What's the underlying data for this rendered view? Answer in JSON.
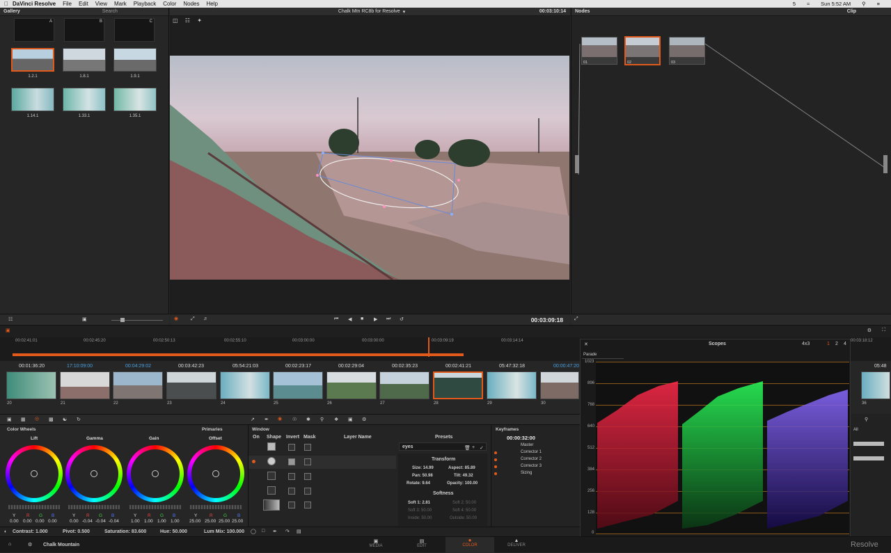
{
  "menubar": {
    "app": "DaVinci Resolve",
    "items": [
      "File",
      "Edit",
      "View",
      "Mark",
      "Playback",
      "Color",
      "Nodes",
      "Help"
    ],
    "clock": "Sun 5:52 AM",
    "battery": "5"
  },
  "gallery": {
    "title": "Gallery",
    "search_placeholder": "Search",
    "albums": [
      "A",
      "B",
      "C"
    ],
    "stills": [
      "1.2.1",
      "1.8.1",
      "1.9.1",
      "1.14.1",
      "1.33.1",
      "1.35.1"
    ]
  },
  "viewer": {
    "title": "Chalk Mtn RC8b for Resolve",
    "timecode_top": "00:03:10:14",
    "timecode": "00:03:09:18"
  },
  "nodes": {
    "title": "Nodes",
    "clip_label": "Clip",
    "node_labels": [
      "01",
      "02",
      "03"
    ]
  },
  "ruler": {
    "ticks": [
      "00:02:41:01",
      "00:02:45:20",
      "00:02:50:13",
      "00:02:55:10",
      "00:03:00:00",
      "00:03:00:00",
      "00:03:09:19",
      "00:03:14:14",
      "00:03:18:12"
    ]
  },
  "clips": {
    "timecodes": [
      "00:01:36:20",
      "17:10:09:00",
      "00:04:29:02",
      "00:03:42:23",
      "05:54:21:03",
      "00:02:23:17",
      "00:02:29:04",
      "00:02:35:23",
      "00:02:41:21",
      "05:47:32:18",
      "00:00:47:20",
      "05:48"
    ],
    "numbers": [
      "20",
      "21",
      "22",
      "23",
      "24",
      "25",
      "26",
      "27",
      "28",
      "29",
      "30",
      "36"
    ],
    "track": "V1"
  },
  "color_wheels": {
    "title": "Color Wheels",
    "mode": "Primaries",
    "wheels": [
      "Lift",
      "Gamma",
      "Gain",
      "Offset"
    ],
    "channels": [
      "Y",
      "R",
      "G",
      "B"
    ],
    "values": [
      [
        "0.00",
        "0.00",
        "0.00",
        "0.00"
      ],
      [
        "0.00",
        "-0.04",
        "-0.04",
        "-0.04"
      ],
      [
        "1.00",
        "1.00",
        "1.00",
        "1.00"
      ],
      [
        "25.00",
        "25.00",
        "25.00",
        "25.00"
      ]
    ]
  },
  "bottom_params": {
    "contrast": "Contrast: 1.000",
    "pivot": "Pivot: 0.500",
    "saturation": "Saturation: 83.600",
    "hue": "Hue: 50.000",
    "lummix": "Lum Mix: 100.000"
  },
  "window": {
    "title": "Window",
    "cols": [
      "On",
      "Shape",
      "Invert",
      "Mask",
      "Layer Name"
    ],
    "presets": "Presets",
    "preset_value": "eyes",
    "transform": "Transform",
    "size": "Size: 14.99",
    "aspect": "Aspect: 85.89",
    "pan": "Pan: 50.98",
    "tilt": "Tilt: 49.32",
    "rotate": "Rotate: 9.64",
    "opacity": "Opacity: 100.00",
    "softness": "Softness",
    "soft1": "Soft 1: 2.81",
    "soft2": "Soft 2: 50.00",
    "soft3": "Soft 3: 50.00",
    "soft4": "Soft 4: 50.00",
    "inside": "Inside: 50.00",
    "outside": "Outside: 50.00"
  },
  "keyframes": {
    "title": "Keyframes",
    "timecode": "00:00:32:00",
    "items": [
      "Master",
      "Corrector 1",
      "Corrector 2",
      "Corrector 3",
      "Sizing"
    ]
  },
  "scopes": {
    "title": "Scopes",
    "mode": "Parade",
    "layout": "4x3",
    "pages": [
      "1",
      "2",
      "4"
    ],
    "scale": [
      "1023",
      "896",
      "768",
      "640",
      "512",
      "384",
      "256",
      "128",
      "0"
    ]
  },
  "footer": {
    "project": "Chalk Mountain",
    "tabs": [
      "MEDIA",
      "EDIT",
      "COLOR",
      "DELIVER"
    ],
    "brand": "Resolve"
  },
  "colors": {
    "accent": "#e25a1b",
    "bg": "#262626",
    "panel": "#2d2d2d"
  }
}
